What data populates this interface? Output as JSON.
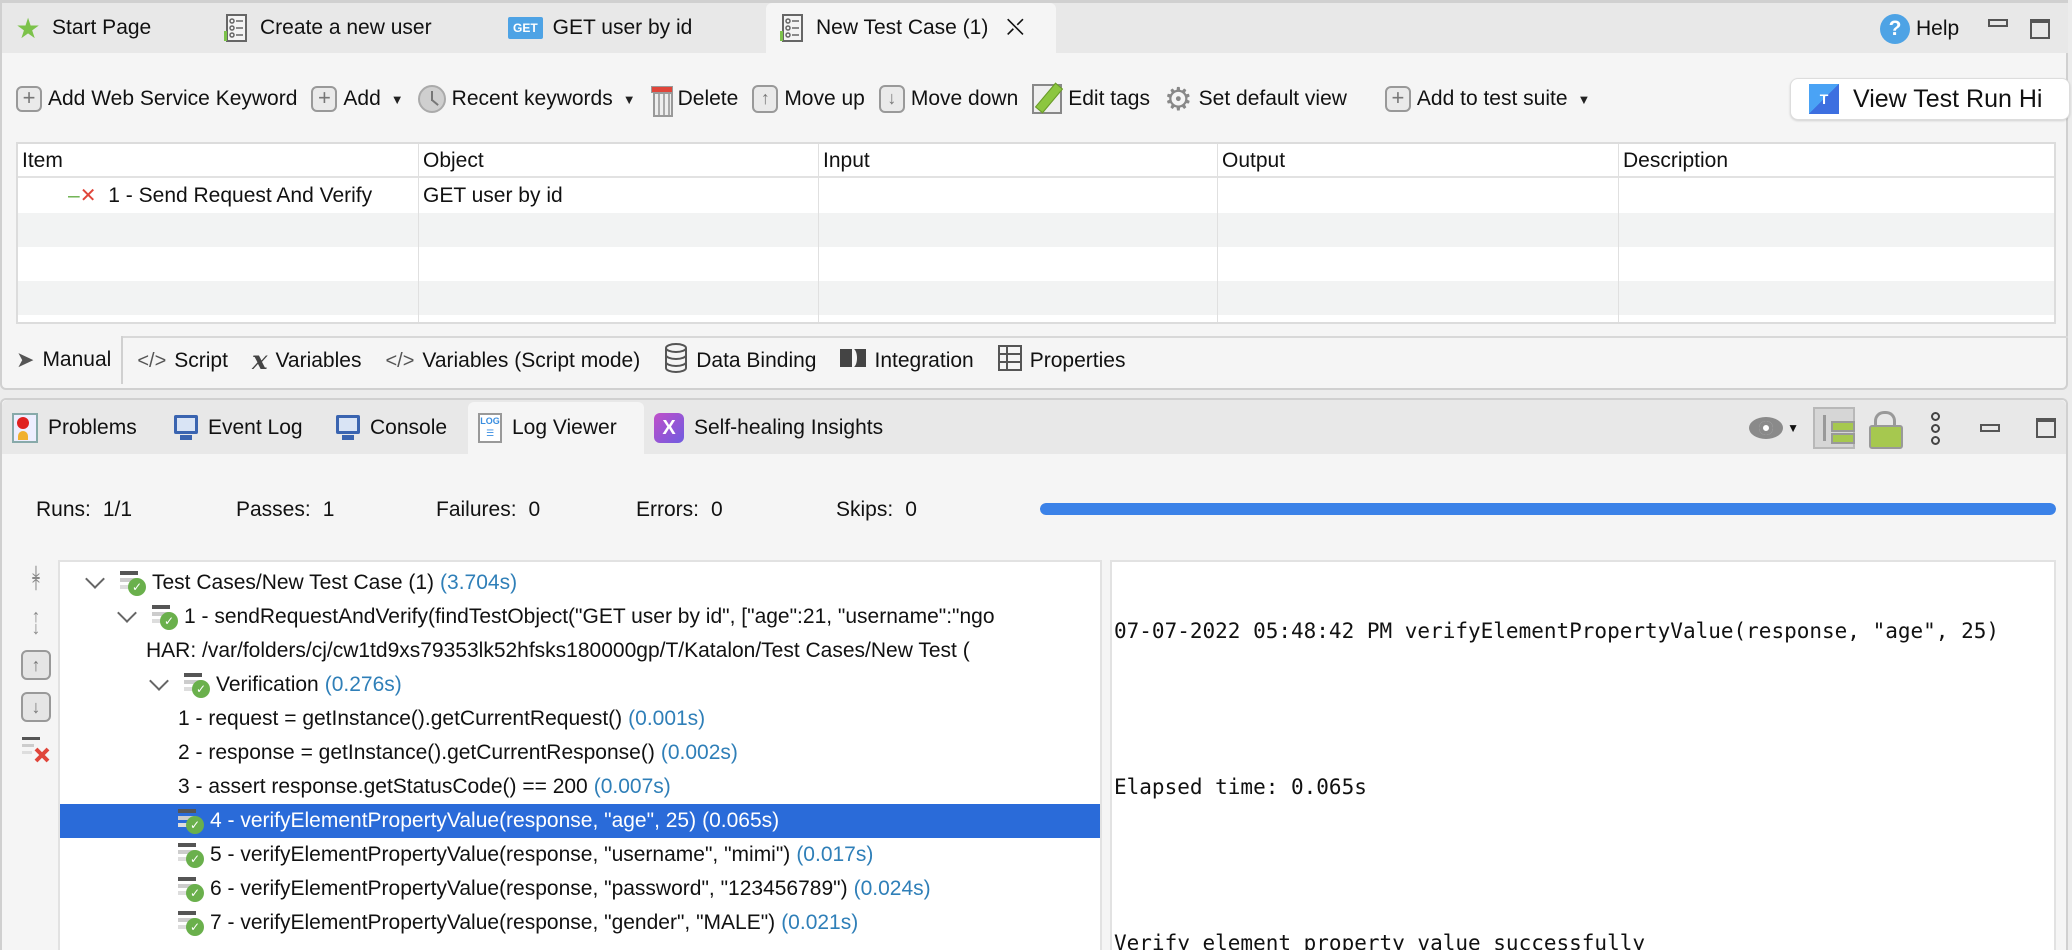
{
  "editor_tabs": [
    {
      "label": "Start Page",
      "icon": "star-icon"
    },
    {
      "label": "Create a new user",
      "icon": "test-case-icon"
    },
    {
      "label": "GET user by id",
      "icon": "get-request-icon",
      "badge": "GET"
    },
    {
      "label": "New Test Case (1)",
      "icon": "test-case-icon",
      "active": true
    }
  ],
  "window": {
    "help_label": "Help"
  },
  "toolbar": {
    "add_ws_keyword": "Add Web Service Keyword",
    "add": "Add",
    "recent_keywords": "Recent keywords",
    "delete": "Delete",
    "move_up": "Move up",
    "move_down": "Move down",
    "edit_tags": "Edit tags",
    "set_default_view": "Set default view",
    "add_to_test_suite": "Add to test suite",
    "view_test_run_history": "View Test Run Hi",
    "testrun_logo": "T"
  },
  "steps_table": {
    "columns": [
      "Item",
      "Object",
      "Input",
      "Output",
      "Description"
    ],
    "rows": [
      {
        "item": "1 - Send Request And Verify",
        "object": "GET user by id",
        "input": "",
        "output": "",
        "description": ""
      }
    ]
  },
  "editor_view_tabs": [
    {
      "label": "Manual",
      "icon": "cursor-icon",
      "active": true
    },
    {
      "label": "Script",
      "icon": "code-icon"
    },
    {
      "label": "Variables",
      "icon": "variable-icon"
    },
    {
      "label": "Variables (Script mode)",
      "icon": "code-icon"
    },
    {
      "label": "Data Binding",
      "icon": "database-icon"
    },
    {
      "label": "Integration",
      "icon": "integration-icon"
    },
    {
      "label": "Properties",
      "icon": "table-icon"
    }
  ],
  "panel_tabs": [
    {
      "label": "Problems",
      "icon": "problems-icon"
    },
    {
      "label": "Event Log",
      "icon": "monitor-icon"
    },
    {
      "label": "Console",
      "icon": "monitor-icon"
    },
    {
      "label": "Log Viewer",
      "icon": "log-icon",
      "active": true
    },
    {
      "label": "Self-healing Insights",
      "icon": "self-healing-icon"
    }
  ],
  "stats": {
    "runs_label": "Runs:",
    "runs": "1/1",
    "passes_label": "Passes:",
    "passes": "1",
    "failures_label": "Failures:",
    "failures": "0",
    "errors_label": "Errors:",
    "errors": "0",
    "skips_label": "Skips:",
    "skips": "0",
    "progress_percent": 100,
    "progress_color": "#3b82e8"
  },
  "log_tree": [
    {
      "text": "Test Cases/New Test Case (1)",
      "duration": "(3.704s)",
      "level": 0,
      "expanded": true,
      "status": "passed"
    },
    {
      "text": "1 - sendRequestAndVerify(findTestObject(\"GET user by id\", [\"age\":21, \"username\":\"ngo",
      "duration": "",
      "level": 1,
      "expanded": true,
      "status": "passed"
    },
    {
      "text": "HAR: /var/folders/cj/cw1td9xs79353lk52hfsks180000gp/T/Katalon/Test Cases/New Test (",
      "duration": "",
      "level": 2,
      "status": "none"
    },
    {
      "text": "Verification",
      "duration": "(0.276s)",
      "level": 2,
      "expanded": true,
      "status": "passed"
    },
    {
      "text": "1 - request = getInstance().getCurrentRequest()",
      "duration": "(0.001s)",
      "level": 3,
      "status": "none"
    },
    {
      "text": "2 - response = getInstance().getCurrentResponse()",
      "duration": "(0.002s)",
      "level": 3,
      "status": "none"
    },
    {
      "text": "3 - assert response.getStatusCode() == 200",
      "duration": "(0.007s)",
      "level": 3,
      "status": "none"
    },
    {
      "text": "4 - verifyElementPropertyValue(response, \"age\", 25)",
      "duration": "(0.065s)",
      "level": 3,
      "status": "passed",
      "selected": true
    },
    {
      "text": "5 - verifyElementPropertyValue(response, \"username\", \"mimi\")",
      "duration": "(0.017s)",
      "level": 3,
      "status": "passed"
    },
    {
      "text": "6 - verifyElementPropertyValue(response, \"password\", \"123456789\")",
      "duration": "(0.024s)",
      "level": 3,
      "status": "passed"
    },
    {
      "text": "7 - verifyElementPropertyValue(response, \"gender\", \"MALE\")",
      "duration": "(0.021s)",
      "level": 3,
      "status": "passed"
    }
  ],
  "detail": {
    "line1": "07-07-2022 05:48:42 PM verifyElementPropertyValue(response, \"age\", 25)",
    "line2": "",
    "line3": "Elapsed time: 0.065s",
    "line4": "",
    "line5": "Verify element property value successfully"
  },
  "colors": {
    "accent": "#2a6bd9",
    "duration": "#2f7fb8",
    "pass": "#6ab04c",
    "fail": "#e0453a"
  }
}
